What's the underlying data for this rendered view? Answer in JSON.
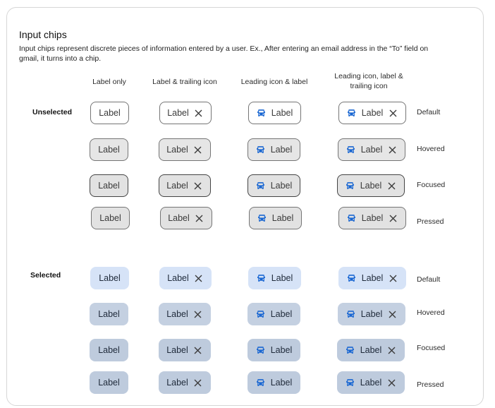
{
  "header": {
    "title": "Input chips",
    "description": "Input chips represent discrete pieces of information entered by a user. Ex., After entering an email address in the “To” field on gmail, it turns into a chip."
  },
  "columns": [
    "Label only",
    "Label & trailing icon",
    "Leading icon & label",
    "Leading icon, label & trailing icon"
  ],
  "sections": {
    "unselected": "Unselected",
    "selected": "Selected"
  },
  "states": [
    "Default",
    "Hovered",
    "Focused",
    "Pressed"
  ],
  "chip": {
    "label": "Label",
    "leading_icon": "car-icon",
    "trailing_icon": "close-icon"
  },
  "colors": {
    "icon_accent": "#1a67d2",
    "selected_default": "#d6e3f7",
    "selected_state": "#c4d0e1",
    "unselected_hover": "#e6e6e6"
  }
}
